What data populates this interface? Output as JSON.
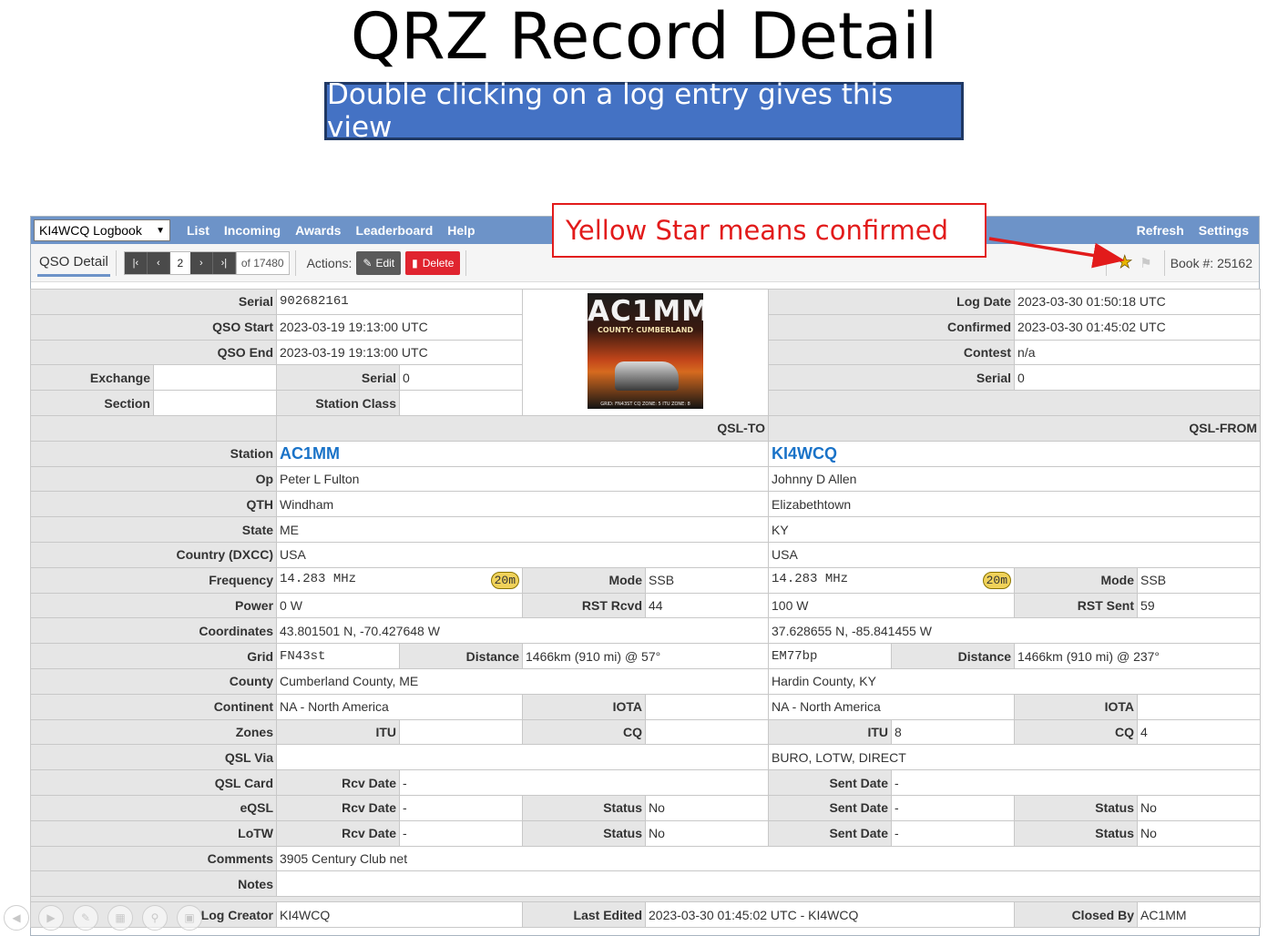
{
  "slide": {
    "title": "QRZ Record Detail",
    "subtitle": "Double clicking on a log entry gives this view",
    "callout": "Yellow Star means confirmed"
  },
  "topbar": {
    "logbook_select": "KI4WCQ Logbook",
    "nav": [
      "List",
      "Incoming",
      "Awards",
      "Leaderboard",
      "Help"
    ],
    "refresh": "Refresh",
    "settings": "Settings"
  },
  "toolbar": {
    "tab": "QSO Detail",
    "page": "2",
    "of_total": "of 17480",
    "actions_label": "Actions:",
    "edit": "Edit",
    "delete": "Delete",
    "book_label": "Book #:",
    "book_number": "25162"
  },
  "qsl_image": {
    "call": "AC1MM",
    "county": "COUNTY: CUMBERLAND",
    "footer": "GRID: FN43ST    CQ ZONE: 5    ITU ZONE: 8"
  },
  "record": {
    "top": {
      "serial_label": "Serial",
      "serial": "902682161",
      "qso_start_label": "QSO Start",
      "qso_start": "2023-03-19 19:13:00 UTC",
      "qso_end_label": "QSO End",
      "qso_end": "2023-03-19 19:13:00 UTC",
      "exchange_label": "Exchange",
      "exchange": "",
      "ex_serial_label": "Serial",
      "ex_serial": "0",
      "section_label": "Section",
      "section": "",
      "station_class_label": "Station Class",
      "station_class": "",
      "log_date_label": "Log Date",
      "log_date": "2023-03-30 01:50:18 UTC",
      "confirmed_label": "Confirmed",
      "confirmed": "2023-03-30 01:45:02 UTC",
      "contest_label": "Contest",
      "contest": "n/a",
      "r_serial_label": "Serial",
      "r_serial": "0"
    },
    "labels": {
      "station": "Station",
      "op": "Op",
      "qth": "QTH",
      "state": "State",
      "country": "Country (DXCC)",
      "frequency": "Frequency",
      "mode": "Mode",
      "power": "Power",
      "rst_rcvd": "RST Rcvd",
      "rst_sent": "RST Sent",
      "coordinates": "Coordinates",
      "grid": "Grid",
      "distance": "Distance",
      "county": "County",
      "continent": "Continent",
      "iota": "IOTA",
      "zones": "Zones",
      "itu": "ITU",
      "cq": "CQ",
      "qsl_via": "QSL Via",
      "qsl_card": "QSL Card",
      "eqsl": "eQSL",
      "lotw": "LoTW",
      "rcv_date": "Rcv Date",
      "sent_date": "Sent Date",
      "status": "Status",
      "comments": "Comments",
      "notes": "Notes",
      "log_creator": "Log Creator",
      "last_edited": "Last Edited",
      "closed_by": "Closed By"
    },
    "to": {
      "header": "QSL-TO",
      "station": "AC1MM",
      "op": "Peter L Fulton",
      "qth": "Windham",
      "state": "ME",
      "country": "USA",
      "frequency": "14.283 MHz",
      "band": "20m",
      "mode": "SSB",
      "power": "0 W",
      "rst": "44",
      "coordinates": "43.801501 N, -70.427648 W",
      "grid": "FN43st",
      "distance": "1466km (910 mi) @ 57°",
      "county": "Cumberland County, ME",
      "continent": "NA - North America",
      "iota": "",
      "itu": "",
      "cq": "",
      "qsl_via": "",
      "qsl_card_date": "-",
      "eqsl_date": "-",
      "eqsl_status": "No",
      "lotw_date": "-",
      "lotw_status": "No"
    },
    "from": {
      "header": "QSL-FROM",
      "station": "KI4WCQ",
      "op": "Johnny D Allen",
      "qth": "Elizabethtown",
      "state": "KY",
      "country": "USA",
      "frequency": "14.283 MHz",
      "band": "20m",
      "mode": "SSB",
      "power": "100 W",
      "rst": "59",
      "coordinates": "37.628655 N, -85.841455 W",
      "grid": "EM77bp",
      "distance": "1466km (910 mi) @ 237°",
      "county": "Hardin County, KY",
      "continent": "NA - North America",
      "iota": "",
      "itu": "8",
      "cq": "4",
      "qsl_via": "BURO, LOTW, DIRECT",
      "qsl_card_date": "-",
      "eqsl_date": "-",
      "eqsl_status": "No",
      "lotw_date": "-",
      "lotw_status": "No"
    },
    "footer": {
      "comments": "3905 Century Club net",
      "notes": "",
      "log_creator": "KI4WCQ",
      "last_edited": "2023-03-30 01:45:02 UTC - KI4WCQ",
      "closed_by": "AC1MM"
    }
  },
  "colors": {
    "nav_bar": "#6d93c8",
    "callsign_link": "#1a73c8",
    "confirmed_star": "#e8b600",
    "delete_button": "#e0242f",
    "callout_red": "#e21b1b"
  },
  "icons": {
    "confirmed": "star-icon",
    "flag": "flag-icon"
  }
}
